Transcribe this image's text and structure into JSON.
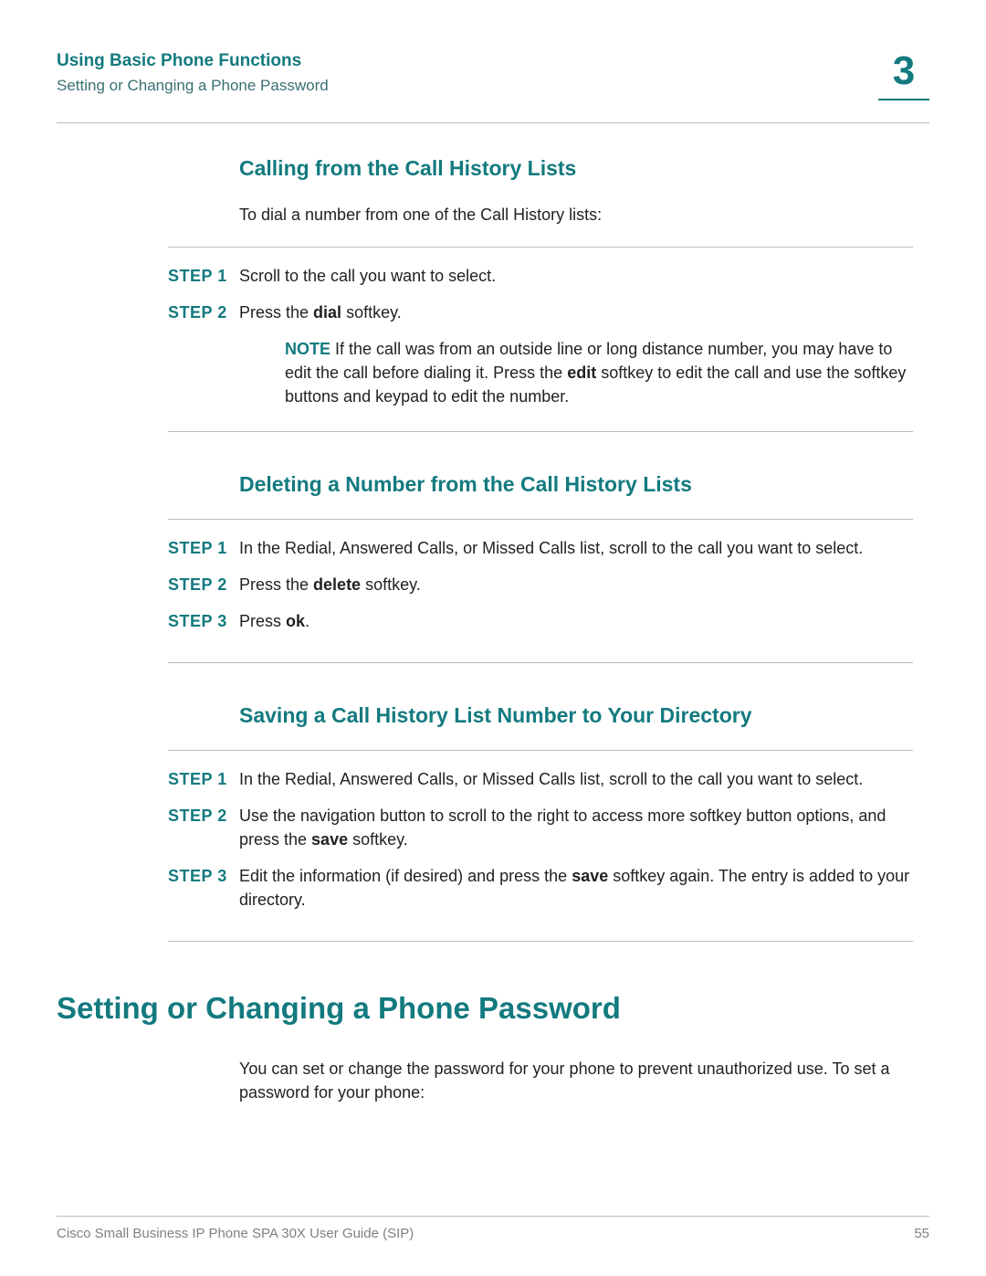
{
  "header": {
    "chapter_title": "Using Basic Phone Functions",
    "breadcrumb": "Setting or Changing a Phone Password",
    "chapter_number": "3"
  },
  "sections": [
    {
      "heading": "Calling from the Call History Lists",
      "intro": "To dial a number from one of the Call History lists:",
      "steps": [
        {
          "label": "STEP  1",
          "text": "Scroll to the call you want to select."
        },
        {
          "label": "STEP  2",
          "html": "Press the <b>dial</b> softkey."
        }
      ],
      "note_label": "NOTE",
      "note_html": "If the call was from an outside line or long distance number, you may have to edit the call before dialing it. Press the <b>edit</b> softkey to edit the call and use the softkey buttons and keypad to edit the number."
    },
    {
      "heading": "Deleting a Number from the Call History Lists",
      "steps": [
        {
          "label": "STEP  1",
          "text": "In the Redial, Answered Calls, or Missed Calls list, scroll to the call you want to select."
        },
        {
          "label": "STEP  2",
          "html": "Press the <b>delete</b> softkey."
        },
        {
          "label": "STEP  3",
          "html": "Press <b>ok</b>."
        }
      ]
    },
    {
      "heading": "Saving a Call History List Number to Your Directory",
      "steps": [
        {
          "label": "STEP  1",
          "text": "In the Redial, Answered Calls, or Missed Calls list, scroll to the call you want to select."
        },
        {
          "label": "STEP  2",
          "html": "Use the navigation button to scroll to the right to access more softkey button options, and press the <b>save</b> softkey."
        },
        {
          "label": "STEP  3",
          "html": "Edit the information (if desired) and press the <b>save</b> softkey again. The entry is added to your directory."
        }
      ]
    }
  ],
  "main_heading": "Setting or Changing a Phone Password",
  "main_intro": "You can set or change the password for your phone to prevent unauthorized use. To set a password for your phone:",
  "footer": {
    "left": "Cisco Small Business IP Phone SPA 30X User Guide (SIP)",
    "page": "55"
  }
}
